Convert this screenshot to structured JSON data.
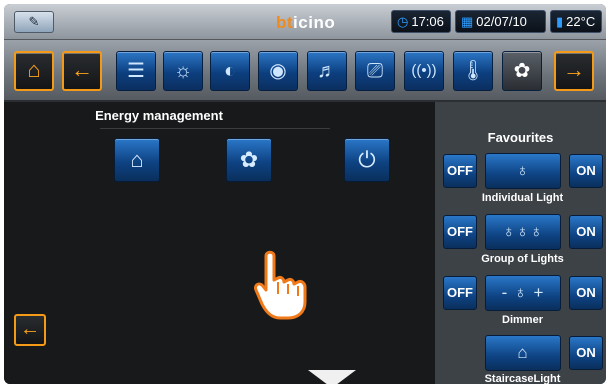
{
  "statusbar": {
    "brand_accent": "bt",
    "brand_rest": "icino",
    "time": "17:06",
    "date": "02/07/10",
    "temperature": "22°C"
  },
  "toolbar": {
    "items": [
      {
        "name": "home",
        "icon": "⌂"
      },
      {
        "name": "back",
        "icon": "←"
      },
      {
        "name": "shutters",
        "icon": "☰"
      },
      {
        "name": "lighting",
        "icon": "☼"
      },
      {
        "name": "scenarios",
        "icon": "◐"
      },
      {
        "name": "audio",
        "icon": "◉"
      },
      {
        "name": "multimedia",
        "icon": "♬"
      },
      {
        "name": "video-door",
        "icon": "⎚"
      },
      {
        "name": "alarm",
        "icon": "((•))"
      },
      {
        "name": "thermo",
        "icon": "🌡"
      },
      {
        "name": "energy",
        "icon": "✿"
      },
      {
        "name": "forward",
        "icon": "→"
      }
    ]
  },
  "main": {
    "title": "Energy management",
    "buttons": [
      {
        "name": "supervision",
        "icon": "⌂"
      },
      {
        "name": "energy-data",
        "icon": "✿"
      },
      {
        "name": "load-control",
        "icon": "⏻"
      }
    ],
    "back_icon": "←"
  },
  "favourites": {
    "title": "Favourites",
    "off_label": "OFF",
    "on_label": "ON",
    "items": [
      {
        "label": "Individual Light",
        "icon": "♁"
      },
      {
        "label": "Group of Lights",
        "icon": "♁♁♁"
      },
      {
        "label": "Dimmer",
        "icon": "- ♁ +"
      },
      {
        "label": "StaircaseLight",
        "icon": "⌂"
      }
    ]
  },
  "colors": {
    "accent_orange": "#f59a16",
    "button_blue": "#0e4383",
    "panel_bg": "#3d4247",
    "screen_bg": "#17191b"
  }
}
